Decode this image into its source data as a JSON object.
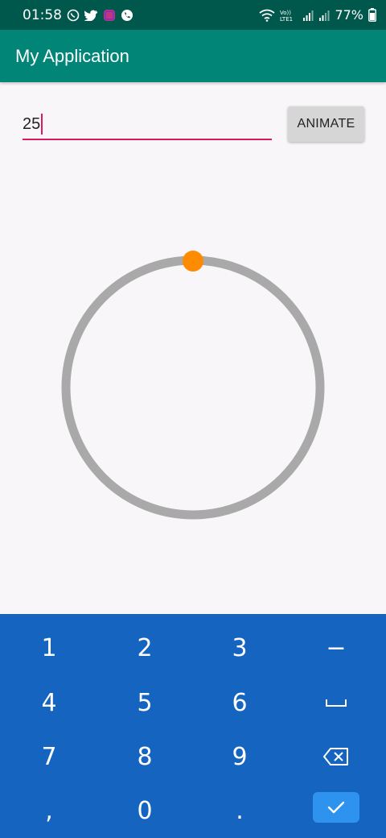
{
  "status_bar": {
    "time": "01:58",
    "battery": "77%",
    "icons_left": [
      "whatsapp-icon",
      "twitter-icon",
      "instagram-icon",
      "phone-icon"
    ],
    "icons_right": [
      "wifi-icon",
      "volte-icon",
      "signal-icon",
      "signal-icon",
      "battery-icon"
    ]
  },
  "app_bar": {
    "title": "My Application"
  },
  "input": {
    "value": "25"
  },
  "animate_button": {
    "label": "ANIMATE"
  },
  "colors": {
    "status_bar": "#00574b",
    "app_bar": "#008577",
    "accent": "#d81b60",
    "circle": "#a9a9a9",
    "dot": "#ff8c00",
    "keyboard": "#1565c0",
    "done_key": "#2e93ee"
  },
  "keyboard": {
    "row1": [
      "1",
      "2",
      "3",
      "−"
    ],
    "row2": [
      "4",
      "5",
      "6",
      "␣"
    ],
    "row3": [
      "7",
      "8",
      "9",
      "backspace-icon"
    ],
    "row4": [
      ",",
      "0",
      ".",
      "check-icon"
    ]
  }
}
